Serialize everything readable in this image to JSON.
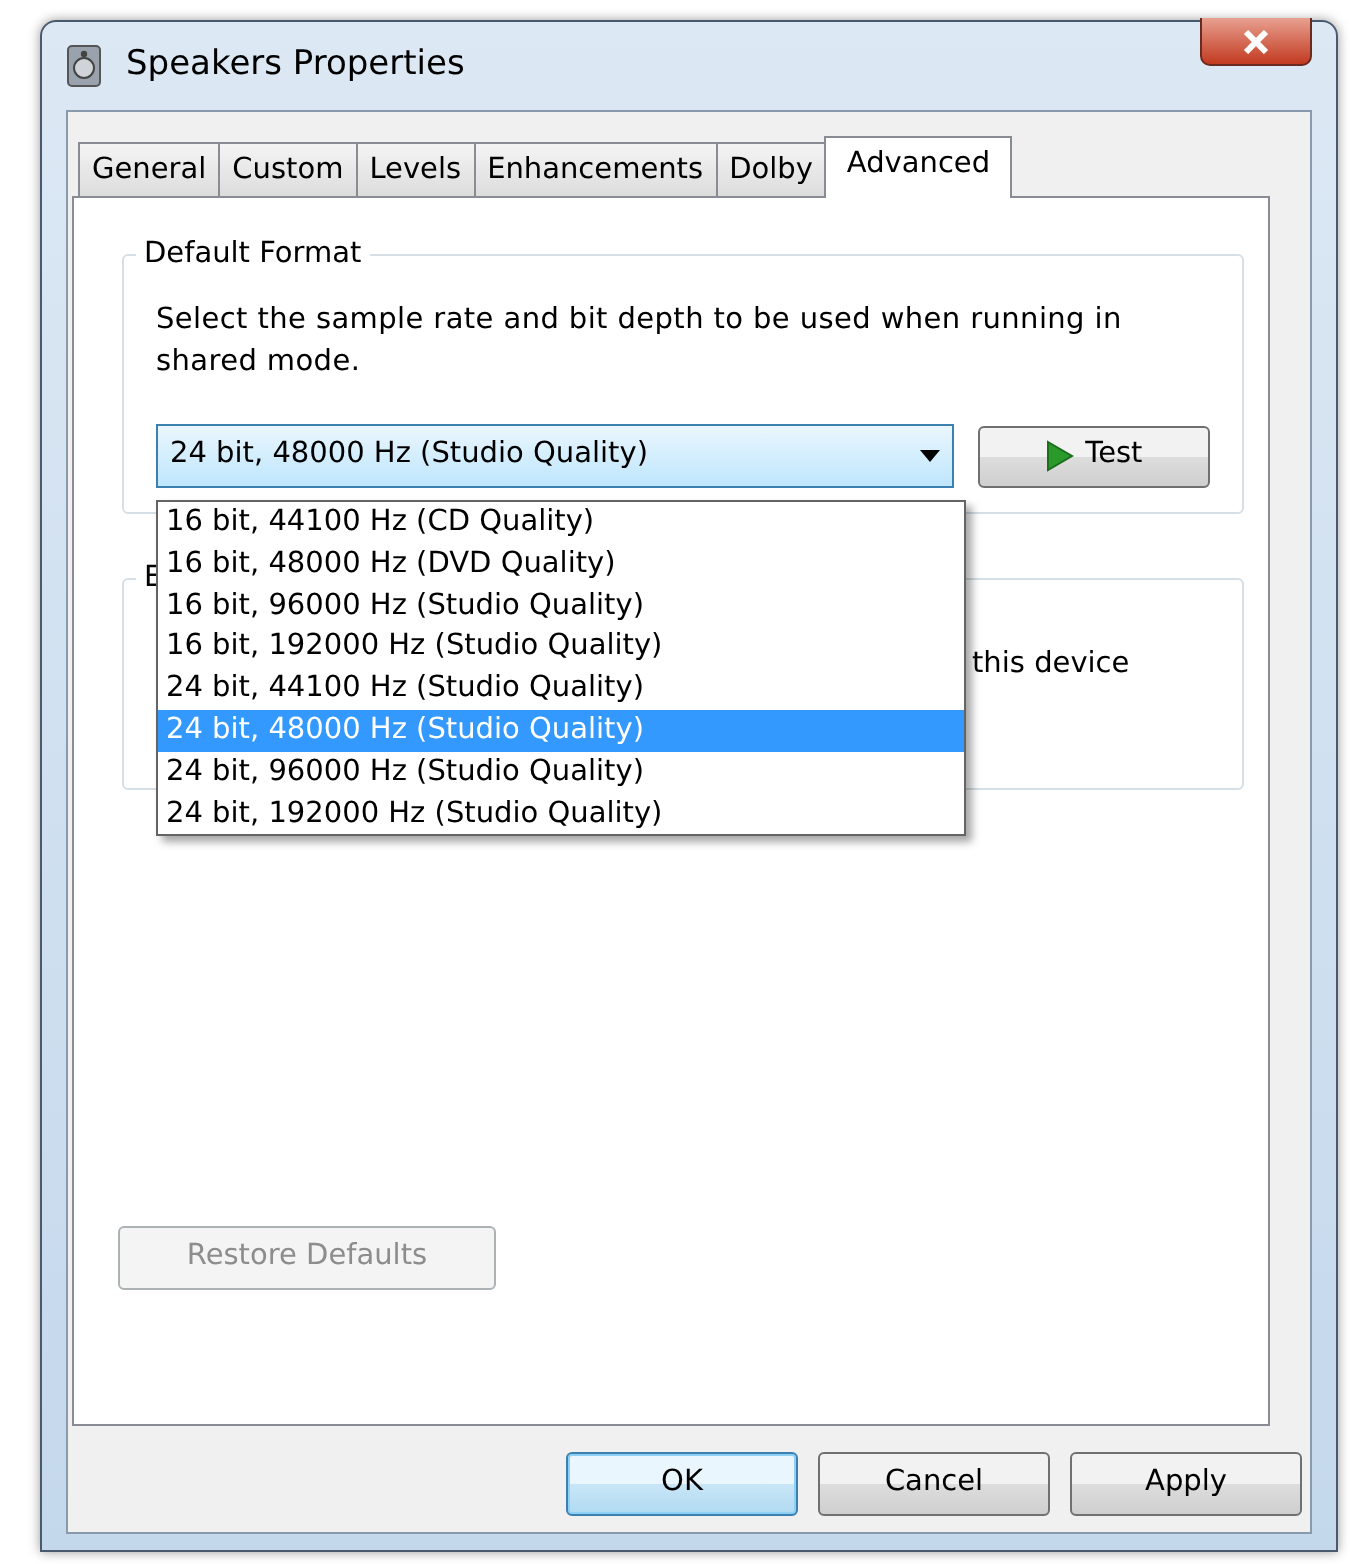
{
  "window": {
    "title": "Speakers Properties"
  },
  "tabs": [
    {
      "label": "General",
      "selected": false
    },
    {
      "label": "Custom",
      "selected": false
    },
    {
      "label": "Levels",
      "selected": false
    },
    {
      "label": "Enhancements",
      "selected": false
    },
    {
      "label": "Dolby",
      "selected": false
    },
    {
      "label": "Advanced",
      "selected": true
    }
  ],
  "default_format": {
    "label": "Default Format",
    "description": "Select the sample rate and bit depth to be used when running in shared mode.",
    "select": {
      "value": "24 bit, 48000 Hz (Studio Quality)",
      "expanded": true
    },
    "test_button": "Test",
    "options": [
      {
        "label": "16 bit, 44100 Hz (CD Quality)",
        "selected": false
      },
      {
        "label": "16 bit, 48000 Hz (DVD Quality)",
        "selected": false
      },
      {
        "label": "16 bit, 96000 Hz (Studio Quality)",
        "selected": false
      },
      {
        "label": "16 bit, 192000 Hz (Studio Quality)",
        "selected": false
      },
      {
        "label": "24 bit, 44100 Hz (Studio Quality)",
        "selected": false
      },
      {
        "label": "24 bit, 48000 Hz (Studio Quality)",
        "selected": true
      },
      {
        "label": "24 bit, 96000 Hz (Studio Quality)",
        "selected": false
      },
      {
        "label": "24 bit, 192000 Hz (Studio Quality)",
        "selected": false
      }
    ]
  },
  "exclusive_mode": {
    "label": "E",
    "text": "this device"
  },
  "restore_button": {
    "label": "Restore Defaults",
    "disabled": true
  },
  "buttons": [
    {
      "label": "OK",
      "default": true
    },
    {
      "label": "Cancel",
      "default": false
    },
    {
      "label": "Apply",
      "default": false
    }
  ]
}
